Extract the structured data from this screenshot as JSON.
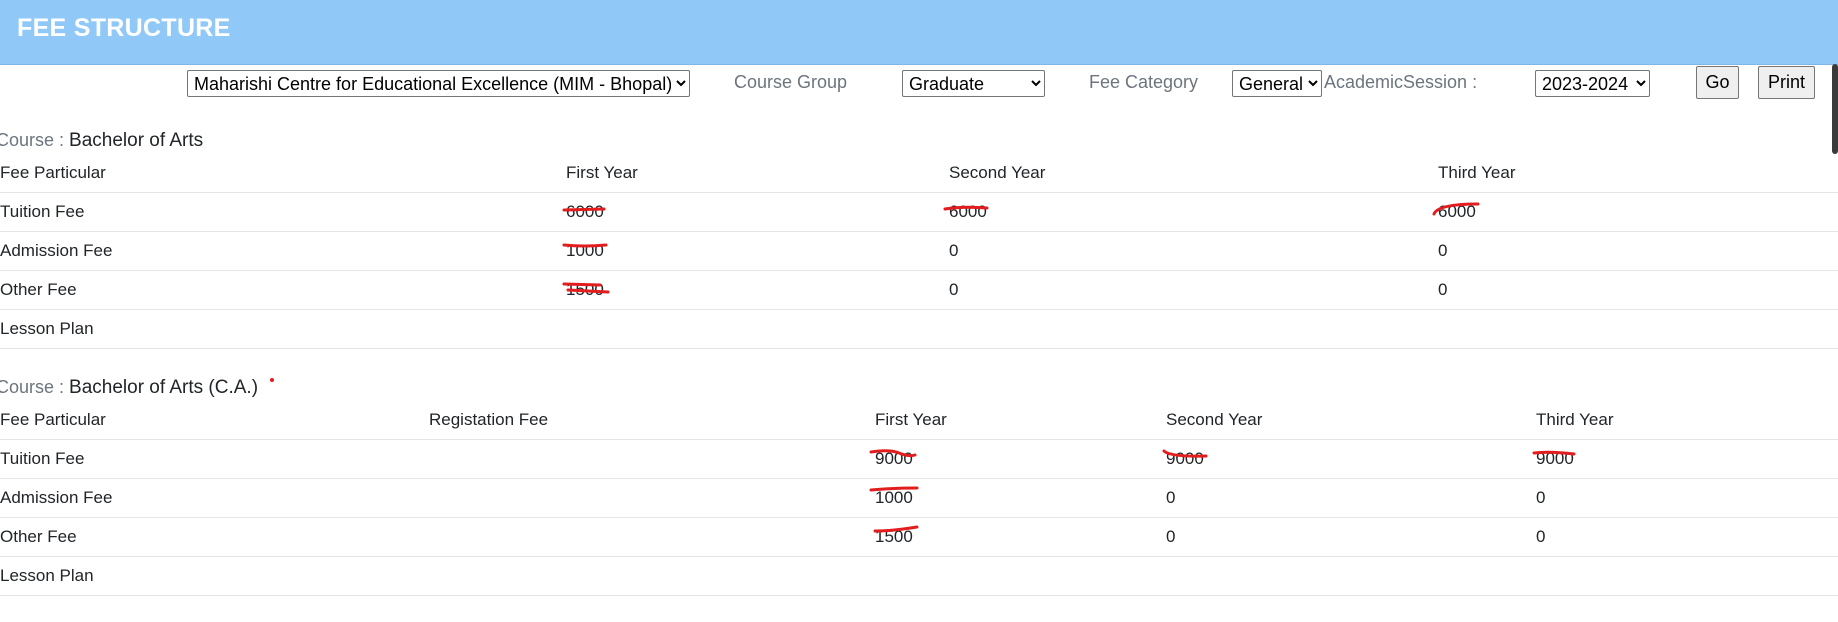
{
  "header": {
    "title": "FEE STRUCTURE"
  },
  "filters": {
    "institution": "Maharishi Centre for Educational Excellence (MIM - Bhopal)",
    "course_group_label": "Course Group",
    "course_group": "Graduate",
    "fee_category_label": "Fee Category",
    "fee_category": "General",
    "session_label": "AcademicSession :",
    "session": "2023-2024",
    "go_label": "Go",
    "print_label": "Print"
  },
  "courses": [
    {
      "prefix": "Course : ",
      "name": "Bachelor of Arts",
      "headers": [
        "Fee Particular",
        "First Year",
        "Second Year",
        "Third Year"
      ],
      "rows": [
        [
          "Tuition Fee",
          "6000",
          "6000",
          "6000"
        ],
        [
          "Admission Fee",
          "1000",
          "0",
          "0"
        ],
        [
          "Other Fee",
          "1500",
          "0",
          "0"
        ],
        [
          "Lesson Plan",
          "",
          "",
          ""
        ]
      ]
    },
    {
      "prefix": "Course : ",
      "name": "Bachelor of Arts (C.A.)",
      "headers": [
        "Fee Particular",
        "Registation Fee",
        "First Year",
        "Second Year",
        "Third Year"
      ],
      "rows": [
        [
          "Tuition Fee",
          "",
          "9000",
          "9000",
          "9000"
        ],
        [
          "Admission Fee",
          "",
          "1000",
          "0",
          "0"
        ],
        [
          "Other Fee",
          "",
          "1500",
          "0",
          "0"
        ],
        [
          "Lesson Plan",
          "",
          "",
          "",
          ""
        ]
      ]
    }
  ],
  "colors": {
    "banner": "#90c9f7",
    "redaction": "#e31d1d"
  }
}
